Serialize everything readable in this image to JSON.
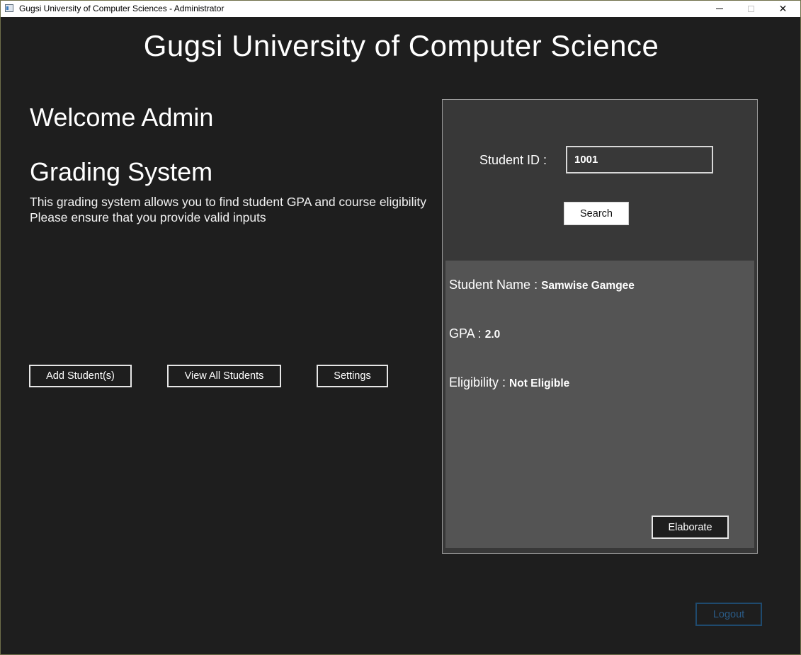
{
  "window": {
    "title": "Gugsi University of Computer Sciences - Administrator",
    "icon": "app-window-icon",
    "controls": {
      "minimize": "minimize-icon",
      "maximize": "maximize-icon",
      "close": "✕"
    }
  },
  "header": {
    "title": "Gugsi University of Computer Science"
  },
  "intro": {
    "welcome": "Welcome Admin",
    "section_title": "Grading System",
    "description_line1": "This grading system allows you to find student GPA and course eligibility",
    "description_line2": "Please ensure that you provide valid inputs"
  },
  "actions": {
    "add_students": "Add Student(s)",
    "view_all_students": "View All Students",
    "settings": "Settings"
  },
  "search_panel": {
    "student_id_label": "Student ID :",
    "student_id_value": "1001",
    "search_button": "Search",
    "results": {
      "name_label": "Student Name :",
      "name_value": "Samwise Gamgee",
      "gpa_label": "GPA :",
      "gpa_value": "2.0",
      "eligibility_label": "Eligibility :",
      "eligibility_value": "Not Eligible",
      "elaborate_button": "Elaborate"
    }
  },
  "footer": {
    "logout_button": "Logout",
    "logout_enabled": false
  },
  "colors": {
    "background": "#1e1e1e",
    "panel": "#383838",
    "results_panel": "#545454",
    "logout_disabled": "#2a5a85"
  }
}
